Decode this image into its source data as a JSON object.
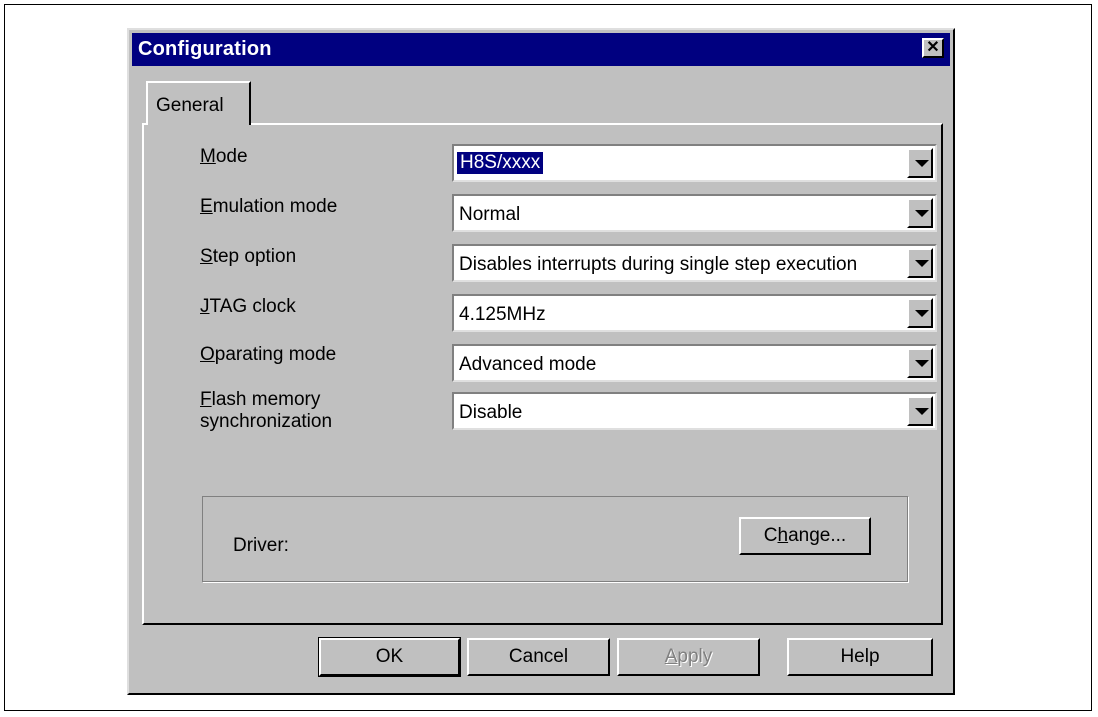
{
  "window": {
    "title": "Configuration",
    "close_symbol": "✕"
  },
  "tabs": [
    {
      "label": "General",
      "active": true
    }
  ],
  "fields": [
    {
      "accel": "M",
      "rest": "ode",
      "value": "H8S/xxxx",
      "selected": true
    },
    {
      "accel": "E",
      "rest": "mulation mode",
      "value": "Normal",
      "selected": false
    },
    {
      "accel": "S",
      "rest": "tep option",
      "value": "Disables interrupts during single step execution",
      "selected": false
    },
    {
      "accel": "J",
      "rest": "TAG clock",
      "value": "4.125MHz",
      "selected": false
    },
    {
      "accel": "O",
      "rest": "parating mode",
      "value": "Advanced mode",
      "selected": false
    },
    {
      "accel": "F",
      "rest": "lash memory",
      "rest2": "synchronization",
      "value": "Disable",
      "selected": false
    }
  ],
  "driver": {
    "label": "Driver:",
    "change_pre": "C",
    "change_accel": "h",
    "change_post": "ange..."
  },
  "buttons": {
    "ok": "OK",
    "cancel": "Cancel",
    "apply_accel": "A",
    "apply_rest": "pply",
    "help": "Help"
  },
  "colors": {
    "titlebar": "#000080",
    "face": "#c0c0c0",
    "selection": "#000080"
  }
}
